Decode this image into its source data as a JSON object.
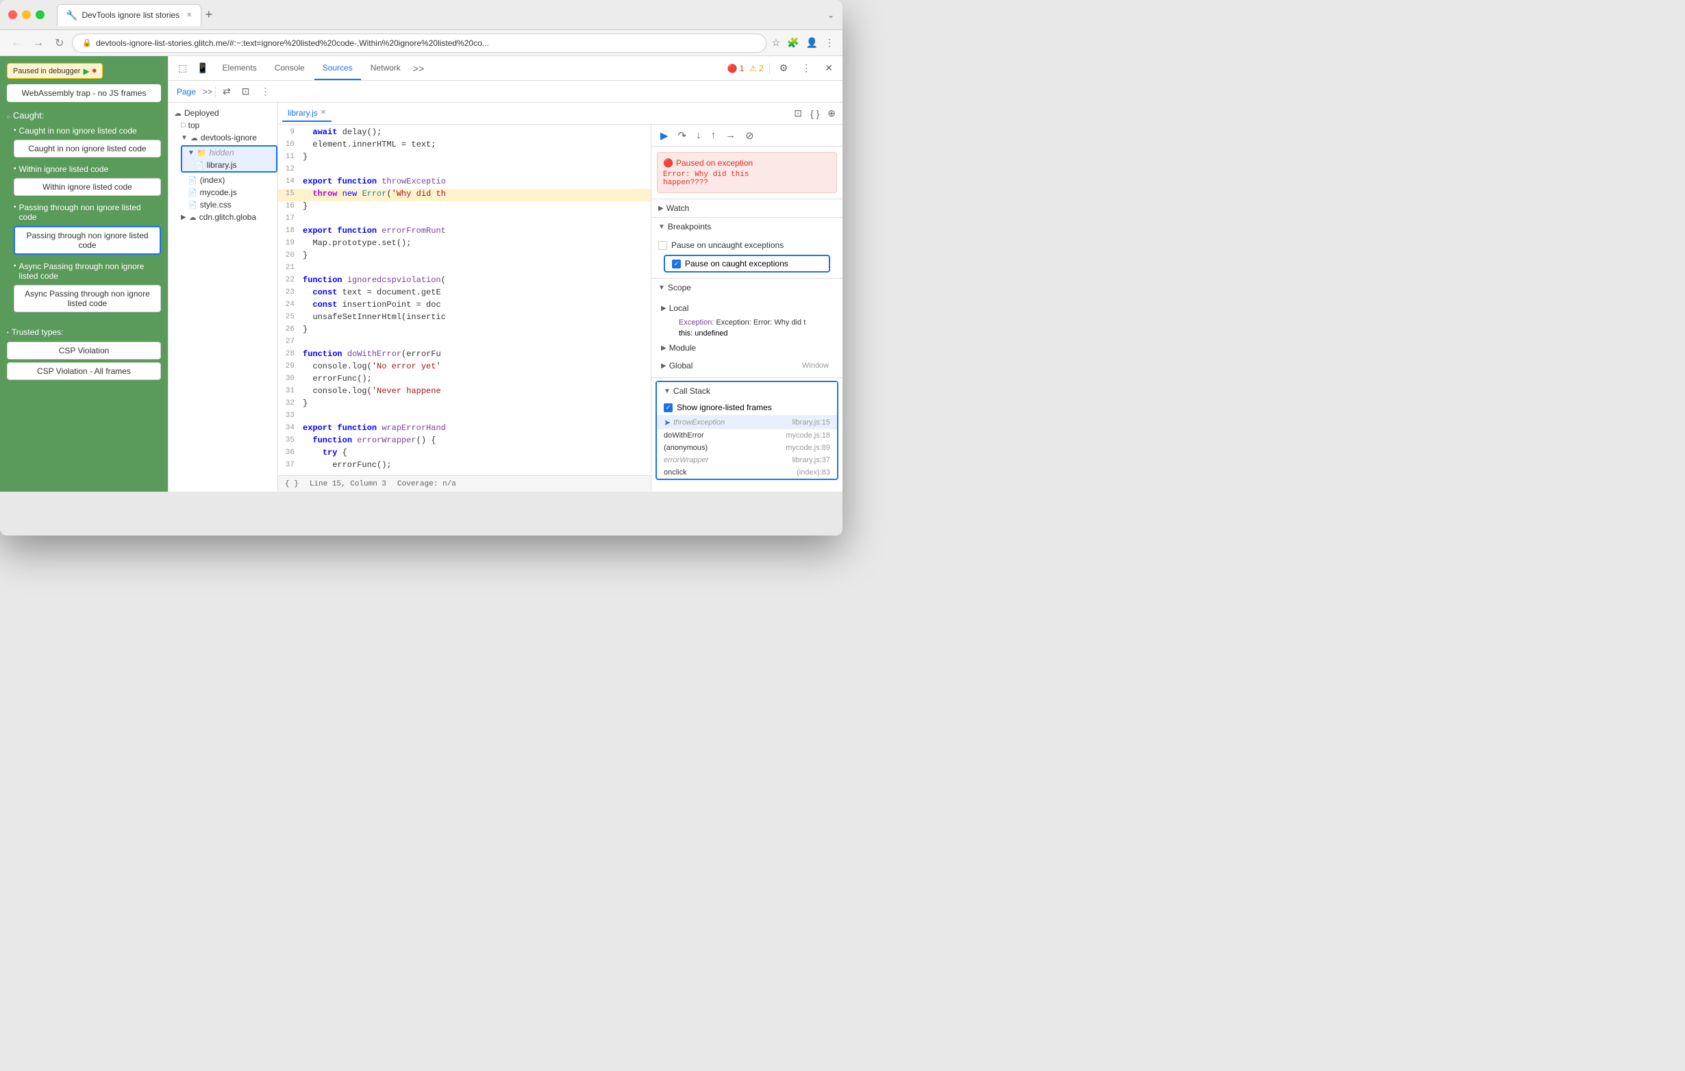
{
  "window": {
    "title": "DevTools ignore list stories",
    "url": "devtools-ignore-list-stories.glitch.me/#:~:text=ignore%20listed%20code-,Within%20ignore%20listed%20co...",
    "paused_badge": "Paused in debugger"
  },
  "tabs": [
    {
      "label": "DevTools ignore list stories",
      "active": true
    }
  ],
  "devtools": {
    "tabs": [
      "Elements",
      "Console",
      "Sources",
      "Network"
    ],
    "active_tab": "Sources",
    "error_count": "1",
    "warn_count": "2"
  },
  "left_panel": {
    "webassembly_label": "WebAssembly trap - no JS frames",
    "caught_title": "Caught:",
    "items": [
      {
        "label": "Caught in non ignore listed code",
        "btn": "Caught in non ignore listed code",
        "selected": false
      },
      {
        "label": "Within ignore listed code",
        "btn": "Within ignore listed code",
        "selected": false
      },
      {
        "label": "Passing through non ignore listed code",
        "btn": "Passing through non ignore listed code",
        "selected": true
      },
      {
        "label": "Async Passing through non ignore listed code",
        "btn": "Async Passing through non ignore listed code",
        "selected": false
      }
    ],
    "trusted_title": "Trusted types:",
    "trusted_items": [
      "CSP Violation",
      "CSP Violation - All frames"
    ]
  },
  "file_tree": {
    "deployed_label": "Deployed",
    "top_label": "top",
    "devtools_ignore_label": "devtools-ignore",
    "hidden_label": "hidden",
    "library_js_label": "library.js",
    "index_label": "(index)",
    "mycode_js_label": "mycode.js",
    "style_css_label": "style.css",
    "cdn_label": "cdn.glitch.globa"
  },
  "editor": {
    "filename": "library.js",
    "lines": [
      {
        "num": 9,
        "content": "  await delay();"
      },
      {
        "num": 10,
        "content": "  element.innerHTML = text;"
      },
      {
        "num": 11,
        "content": "}"
      },
      {
        "num": 12,
        "content": ""
      },
      {
        "num": 14,
        "content": "export function throwExceptio"
      },
      {
        "num": 15,
        "content": "  throw new Error('Why did th",
        "highlighted": true
      },
      {
        "num": 16,
        "content": "}"
      },
      {
        "num": 17,
        "content": ""
      },
      {
        "num": 18,
        "content": "export function errorFromRunt"
      },
      {
        "num": 19,
        "content": "  Map.prototype.set();"
      },
      {
        "num": 20,
        "content": "}"
      },
      {
        "num": 21,
        "content": ""
      },
      {
        "num": 22,
        "content": "function ignoredcspviolation("
      },
      {
        "num": 23,
        "content": "  const text = document.getE"
      },
      {
        "num": 24,
        "content": "  const insertionPoint = doc"
      },
      {
        "num": 25,
        "content": "  unsafeSetInnerHtml(insertic"
      },
      {
        "num": 26,
        "content": "}"
      },
      {
        "num": 27,
        "content": ""
      },
      {
        "num": 28,
        "content": "function doWithError(errorFu"
      },
      {
        "num": 29,
        "content": "  console.log('No error yet'"
      },
      {
        "num": 30,
        "content": "  errorFunc();"
      },
      {
        "num": 31,
        "content": "  console.log('Never happene"
      },
      {
        "num": 32,
        "content": "}"
      },
      {
        "num": 33,
        "content": ""
      },
      {
        "num": 34,
        "content": "export function wrapErrorHand"
      },
      {
        "num": 35,
        "content": "  function errorWrapper() {"
      },
      {
        "num": 36,
        "content": "    try {"
      },
      {
        "num": 37,
        "content": "      errorFunc();"
      }
    ],
    "footer": {
      "line_col": "Line 15, Column 3",
      "coverage": "Coverage: n/a"
    }
  },
  "right_panel": {
    "exception": {
      "title": "Paused on exception",
      "message": "Error: Why did this\nhappen????"
    },
    "watch_label": "Watch",
    "breakpoints_label": "Breakpoints",
    "pause_uncaught_label": "Pause on uncaught exceptions",
    "pause_caught_label": "Pause on caught exceptions",
    "scope_label": "Scope",
    "local_label": "Local",
    "local_exception": "Exception: Error: Why did t",
    "local_this": "this: undefined",
    "module_label": "Module",
    "global_label": "Global",
    "global_value": "Window",
    "callstack_label": "Call Stack",
    "show_ignored_label": "Show ignore-listed frames",
    "frames": [
      {
        "name": "throwException",
        "location": "library.js:15",
        "active": true,
        "ignored": true,
        "arrow": true
      },
      {
        "name": "doWithError",
        "location": "mycode.js:18",
        "active": false,
        "ignored": false
      },
      {
        "name": "(anonymous)",
        "location": "mycode.js:89",
        "active": false,
        "ignored": false
      },
      {
        "name": "errorWrapper",
        "location": "library.js:37",
        "active": false,
        "ignored": true
      },
      {
        "name": "onclick",
        "location": "(index):83",
        "active": false,
        "ignored": false
      }
    ]
  }
}
